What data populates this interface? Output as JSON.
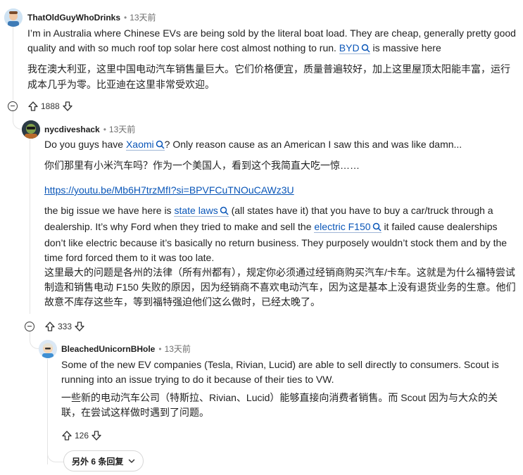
{
  "comments": [
    {
      "username": "ThatOldGuyWhoDrinks",
      "time": "13天前",
      "text_a": "I’m in Australia where Chinese EVs are being sold by the literal boat load. They are cheap, generally pretty good quality and with so much roof top solar here cost almost nothing to run.",
      "keyword": "BYD",
      "text_b": "is massive here",
      "zh": "我在澳大利亚，这里中国电动汽车销售量巨大。它们价格便宜，质量普遍较好，加上这里屋顶太阳能丰富，运行成本几乎为零。比亚迪在这里非常受欢迎。",
      "votes": "1888"
    },
    {
      "username": "nycdiveshack",
      "time": "13天前",
      "p1_a": "Do you guys have",
      "p1_kw": "Xaomi",
      "p1_b": "? Only reason cause as an American I saw this and was like damn...",
      "p1_zh": "你们那里有小米汽车吗？作为一个美国人，看到这个我简直大吃一惊……",
      "url": "https://youtu.be/Mb6H7trzMfI?si=BPVFCuTNOuCAWz3U",
      "p3_a": "the big issue we have here is",
      "p3_kw1": "state laws",
      "p3_b": "(all states have it) that you have to buy a car/truck through a dealership. It’s why Ford when they tried to make and sell the",
      "p3_kw2": "electric F150",
      "p3_c": "it failed cause dealerships don’t like electric because it’s basically no return business. They purposely wouldn’t stock them and by the time ford forced them to it was too late.",
      "p3_zh": "这里最大的问题是各州的法律（所有州都有），规定你必须通过经销商购买汽车/卡车。这就是为什么福特尝试制造和销售电动 F150 失败的原因，因为经销商不喜欢电动汽车，因为这是基本上没有退货业务的生意。他们故意不库存这些车，等到福特强迫他们这么做时，已经太晚了。",
      "votes": "333"
    },
    {
      "username": "BleachedUnicornBHole",
      "time": "13天前",
      "text": "Some of the new EV companies (Tesla, Rivian, Lucid) are able to sell directly to consumers. Scout is running into an issue trying to do it because of their ties to VW.",
      "zh": "一些新的电动汽车公司（特斯拉、Rivian、Lucid）能够直接向消费者销售。而 Scout 因为与大众的关联，在尝试这样做时遇到了问题。",
      "votes": "126"
    }
  ],
  "more_replies": "另外 6 条回复",
  "icons": {
    "search": "search-icon",
    "upvote": "upvote-icon",
    "downvote": "downvote-icon",
    "collapse": "collapse-icon",
    "chevron": "chevron-down-icon"
  }
}
